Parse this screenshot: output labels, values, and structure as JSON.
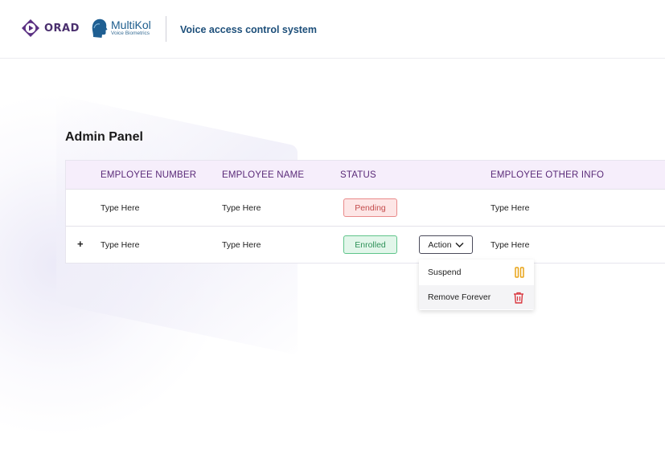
{
  "header": {
    "orad_logo_text": "ORAD",
    "multikol_name": "MultiKol",
    "multikol_sub": "Voice Biometrics",
    "app_title": "Voice access control system"
  },
  "page_title": "Admin Panel",
  "table": {
    "columns": [
      "EMPLOYEE NUMBER",
      "EMPLOYEE NAME",
      "STATUS",
      "EMPLOYEE OTHER INFO"
    ],
    "rows": [
      {
        "expand": "",
        "employee_number": "Type Here",
        "employee_name": "Type Here",
        "status": "Pending",
        "other_info": "Type Here"
      },
      {
        "expand": "+",
        "employee_number": "Type Here",
        "employee_name": "Type Here",
        "status": "Enrolled",
        "action_label": "Action",
        "other_info": "Type Here"
      }
    ]
  },
  "dropdown": {
    "items": [
      {
        "label": "Suspend",
        "icon": "pause-icon",
        "color": "#e8a317"
      },
      {
        "label": "Remove Forever",
        "icon": "trash-icon",
        "color": "#d9363e"
      }
    ]
  },
  "colors": {
    "brand_purple": "#4a2f6e",
    "header_text": "#5a2a78",
    "title_blue": "#1d4f7a",
    "pending": "#c44c4c",
    "enrolled": "#2e9158"
  }
}
